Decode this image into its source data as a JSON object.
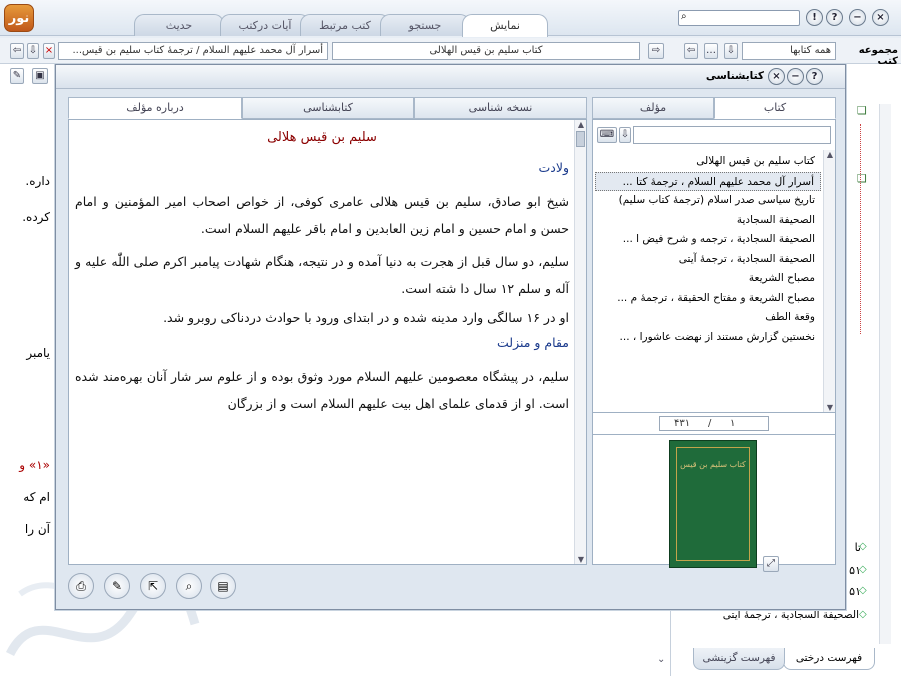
{
  "app": {
    "logo": "نور"
  },
  "tabs": [
    {
      "label": "نمایش",
      "active": true
    },
    {
      "label": "جستجو",
      "active": false
    },
    {
      "label": "کتب مرتبط",
      "active": false
    },
    {
      "label": "آیات درکتب",
      "active": false
    },
    {
      "label": "حدیث",
      "active": false
    }
  ],
  "window_buttons": {
    "close": "×",
    "minimize": "−",
    "help": "?",
    "info": "!"
  },
  "address_bar": {
    "collection_label": "مجموعه کتب",
    "collection_value": "همه کتابها",
    "book_field": "کتاب سلیم بن قیس الهلالی",
    "breadcrumb": "أسرار آل محمد علیهم السلام / ترجمهٔ کتاب سلیم بن قیس..."
  },
  "background_doc": {
    "fragments": [
      "داره.",
      "کرده.",
      "یامبر",
      "«۱» و",
      "ام که",
      "آن را"
    ]
  },
  "right_tree": {
    "items": [
      "تا",
      "۵۱",
      "۵۱",
      "الصحیفة السجادیة ، ترجمهٔ آیتی"
    ],
    "tabs": [
      "فهرست درختی",
      "فهرست گزینشی"
    ]
  },
  "dialog": {
    "title": "کتابشناسی",
    "left_tabs": [
      "درباره مؤلف",
      "کتابشناسی",
      "نسخه شناسی"
    ],
    "right_tabs": [
      "کتاب",
      "مؤلف"
    ],
    "author_name": "سلیم بن قیس هلالی",
    "sections": [
      {
        "type": "heading",
        "text": "ولادت"
      },
      {
        "type": "para",
        "text": "شیخ ابو صادق، سلیم بن قیس هلالی عامری کوفی، از خواص اصحاب امیر المؤمنین و امام حسن و امام حسین و امام زین العابدین و امام باقر علیهم السلام است."
      },
      {
        "type": "para",
        "text": "سلیم، دو سال قبل از هجرت به دنیا آمده و در نتیجه، هنگام شهادت پیامبر اکرم صلی اللّٰه علیه و آله و سلم ۱۲ سال دا شته است."
      },
      {
        "type": "para",
        "text": "او در ۱۶ سالگی وارد مدینه شده و در ابتدای ورود با حوادث دردناکی روبرو شد."
      },
      {
        "type": "heading",
        "text": "مقام و منزلت"
      },
      {
        "type": "para",
        "text": "سلیم، در پیشگاه معصومین علیهم السلام مورد وثوق بوده و از علوم سر شار آنان بهره‌مند شده است. او از قدمای علمای اهل بیت علیهم السلام است و از بزرگان"
      }
    ],
    "book_list": [
      {
        "label": "کتاب سلیم بن قیس الهلالی",
        "selected": false
      },
      {
        "label": "أسرار آل محمد علیهم السلام ، ترجمهٔ کتا ...",
        "selected": true
      },
      {
        "label": "تاریخ سیاسی صدر اسلام (ترجمهٔ کتاب سلیم)",
        "selected": false
      },
      {
        "label": "الصحیفة السجادیة",
        "selected": false
      },
      {
        "label": "الصحیفة السجادیة ، ترجمه و شرح فیض ا ...",
        "selected": false
      },
      {
        "label": "الصحیفة السجادیة ، ترجمهٔ آیتی",
        "selected": false
      },
      {
        "label": "مصباح الشریعة",
        "selected": false
      },
      {
        "label": "مصباح الشریعة و مفتاح الحقیقة ، ترجمهٔ م ...",
        "selected": false
      },
      {
        "label": "وقعة الطف",
        "selected": false
      },
      {
        "label": "نخستین گزارش مستند از نهضت عاشورا ، ...",
        "selected": false
      }
    ],
    "pager": {
      "current": "۱",
      "total": "۴۳۱"
    },
    "cover_title": "کتاب سلیم بن قیس"
  },
  "colors": {
    "author_name": "#8b0000",
    "heading": "#1a3a8c",
    "book_cover": "#1f6b3a"
  }
}
